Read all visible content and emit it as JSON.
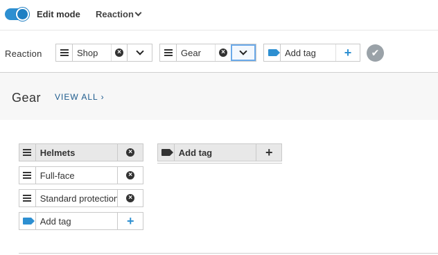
{
  "topbar": {
    "edit_mode_label": "Edit mode",
    "edit_mode_on": true,
    "reaction_menu_label": "Reaction"
  },
  "toolbar": {
    "row_label": "Reaction",
    "shop_tag": "Shop",
    "gear_tag": "Gear",
    "add_tag_placeholder": "Add tag"
  },
  "band": {
    "title": "Gear",
    "view_all_label": "VIEW ALL ›"
  },
  "columns": [
    {
      "title": "Helmets",
      "items": [
        "Full-face",
        "Standard protection"
      ],
      "add_tag_label": "Add tag"
    },
    {
      "title": "Add tag"
    }
  ],
  "colors": {
    "accent": "#2d8fd1",
    "link": "#1c5a8c",
    "band_bg": "#f7f7f7",
    "confirm": "#9aa2a8"
  }
}
